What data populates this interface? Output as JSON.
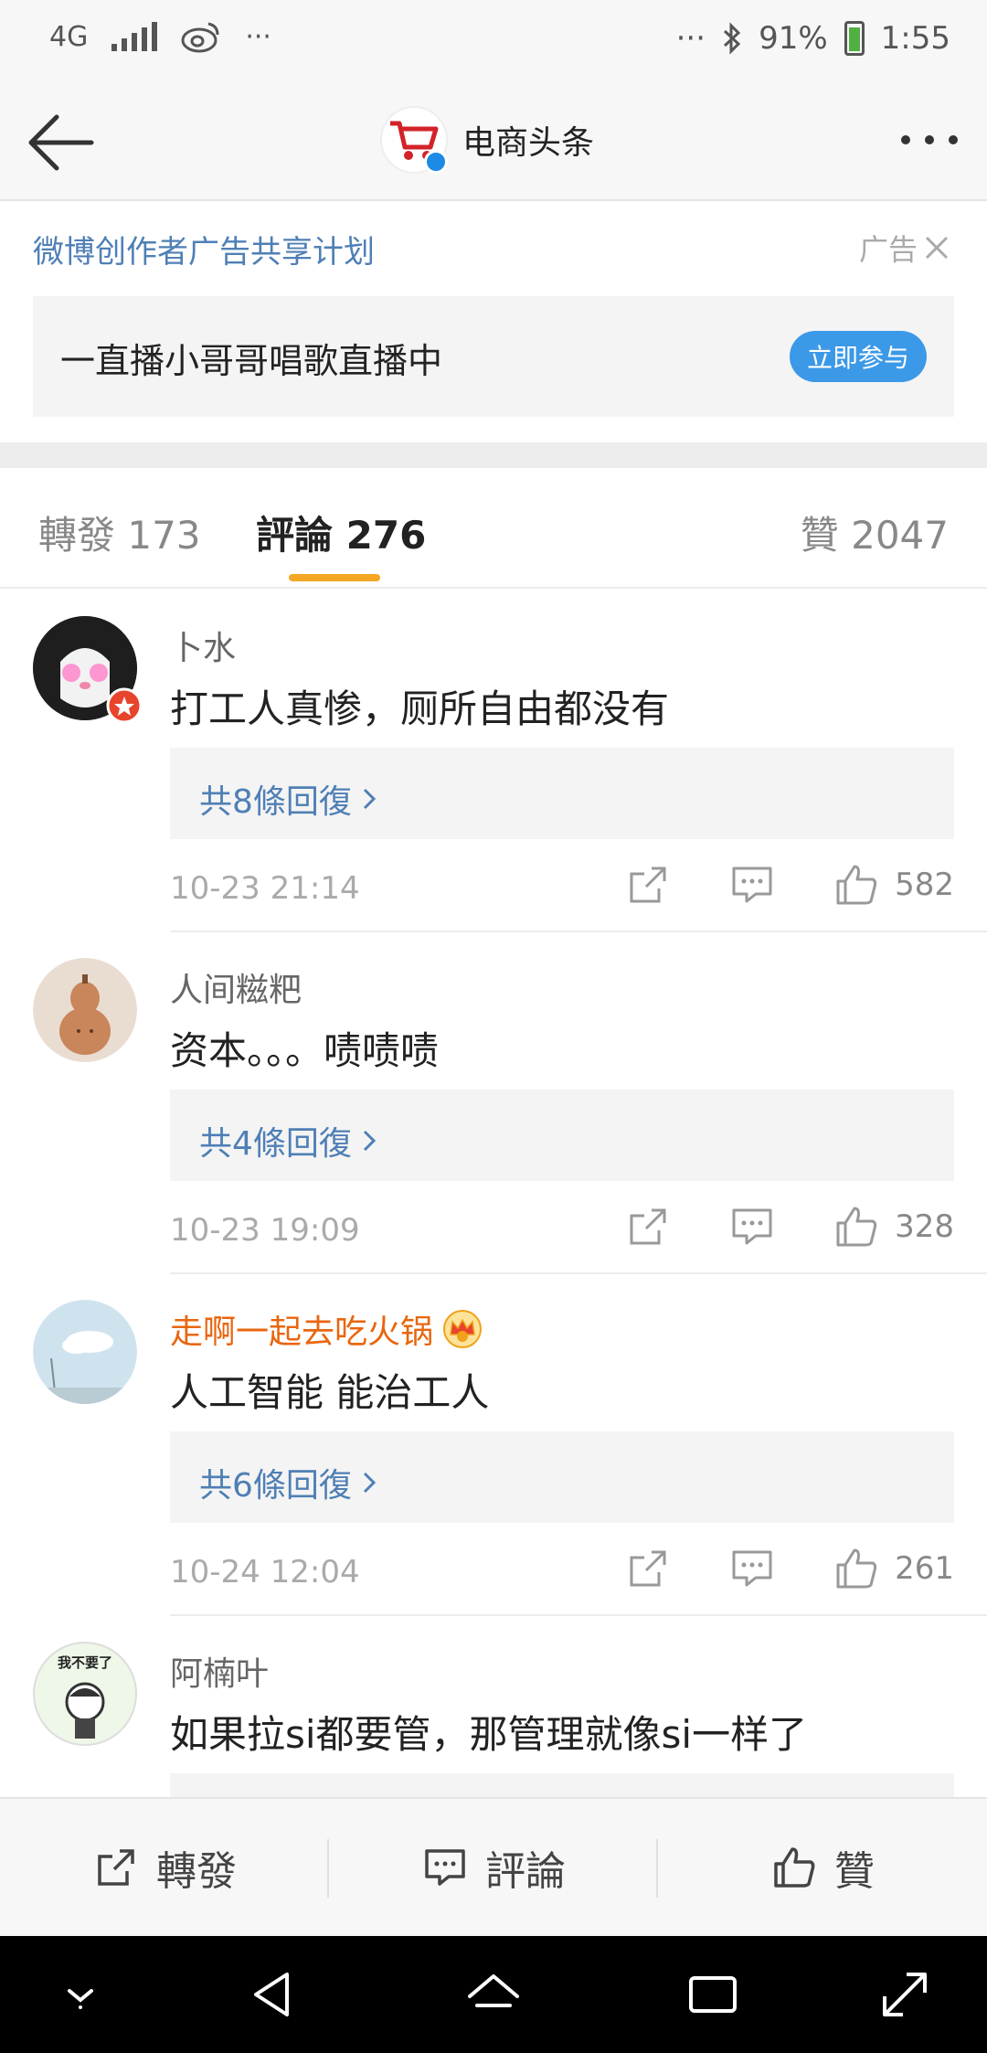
{
  "status": {
    "network": "4G",
    "dots": "···",
    "battery": "91%",
    "time": "1:55"
  },
  "nav": {
    "title": "电商头条"
  },
  "ad": {
    "plan": "微博创作者广告共享计划",
    "label": "广告",
    "text": "一直播小哥哥唱歌直播中",
    "cta": "立即参与"
  },
  "tabs": {
    "repost": "轉發 173",
    "comments": "評論 276",
    "likes": "贊 2047"
  },
  "comments": [
    {
      "name": "卜水",
      "text": "打工人真惨，厕所自由都没有",
      "replies": "共8條回復",
      "time": "10-23 21:14",
      "likes": "582"
    },
    {
      "name": "人间糍粑",
      "text": "资本。。。啧啧啧",
      "replies": "共4條回復",
      "time": "10-23 19:09",
      "likes": "328"
    },
    {
      "name": "走啊一起去吃火锅",
      "text": "人工智能 能治工人",
      "replies": "共6條回復",
      "time": "10-24 12:04",
      "likes": "261"
    },
    {
      "name": "阿楠叶",
      "text": "如果拉si都要管，那管理就像si一样了"
    }
  ],
  "avatar4_text": "我不要了",
  "toolbar": {
    "repost": "轉發",
    "comment": "評論",
    "like": "贊"
  },
  "icons": {
    "back": "arrow-left-icon",
    "more": "more-dots-icon",
    "close": "close-icon",
    "share": "share-icon",
    "comment": "comment-icon",
    "like": "thumbs-up-icon",
    "vip": "crown-icon"
  },
  "colors": {
    "link": "#4f7fb5",
    "vip_name": "#e8660f",
    "cta": "#3b99e8",
    "tab_underline": "#f5a623"
  }
}
